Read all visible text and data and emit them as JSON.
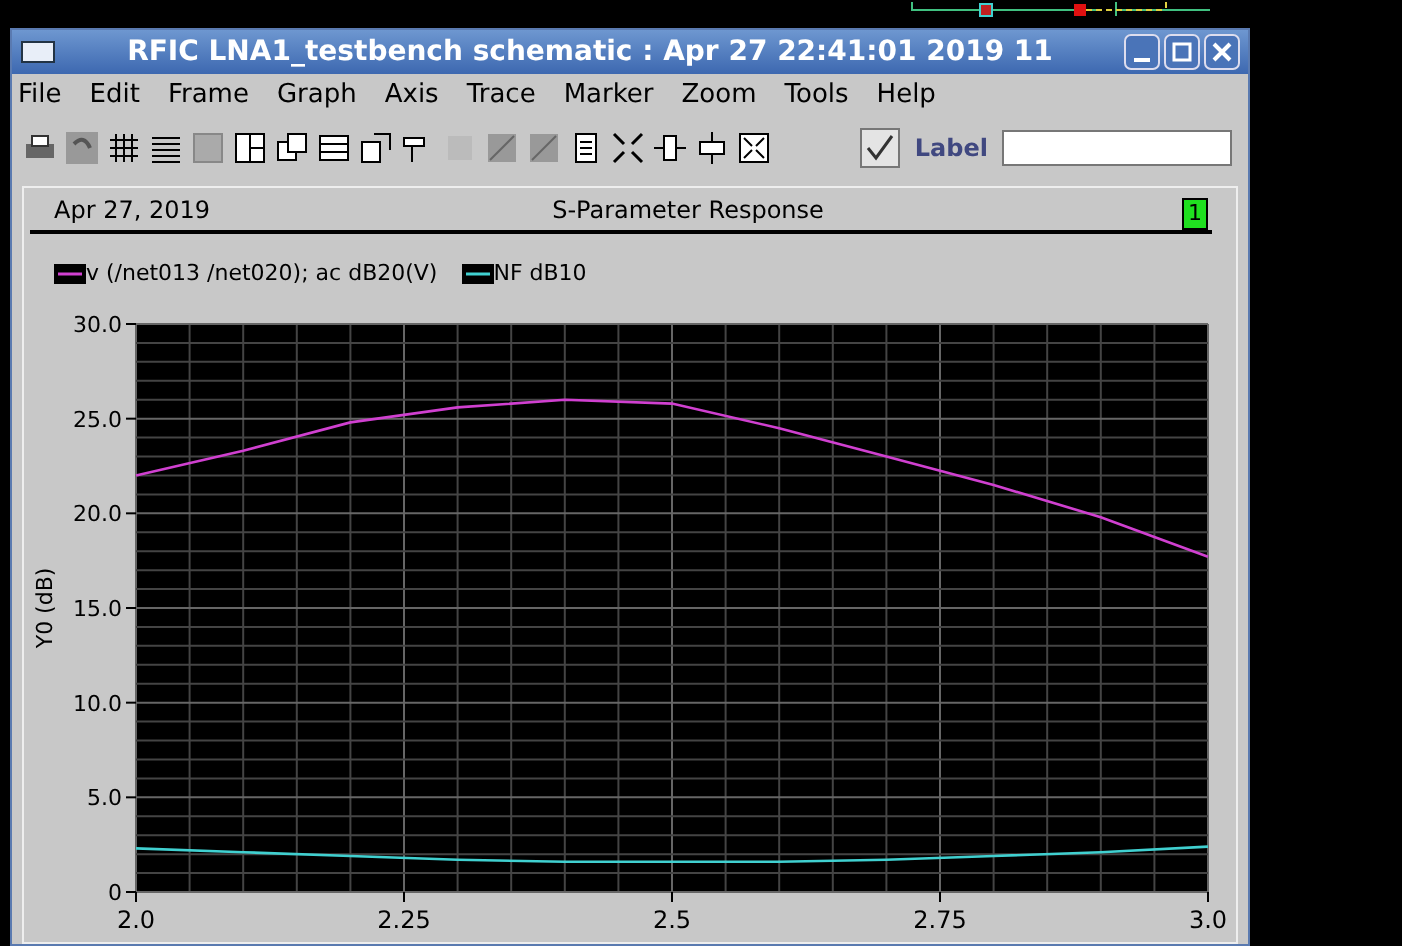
{
  "window": {
    "title": "RFIC LNA1_testbench schematic : Apr 27 22:41:01 2019 11"
  },
  "menu": [
    "File",
    "Edit",
    "Frame",
    "Graph",
    "Axis",
    "Trace",
    "Marker",
    "Zoom",
    "Tools",
    "Help"
  ],
  "toolbar": {
    "label_checkbox": {
      "label": "Label",
      "checked": true
    }
  },
  "panel": {
    "date": "Apr 27, 2019",
    "title": "S-Parameter Response",
    "page": "1"
  },
  "chart": {
    "chart_data": {
      "type": "line",
      "ylabel": "Y0 (dB)",
      "x": [
        2.0,
        2.1,
        2.2,
        2.3,
        2.4,
        2.5,
        2.6,
        2.7,
        2.8,
        2.9,
        3.0
      ],
      "series": [
        {
          "name": "v (/net013 /net020); ac dB20(V)",
          "color": "#d040d0",
          "values": [
            22.0,
            23.3,
            24.8,
            25.6,
            26.0,
            25.8,
            24.5,
            23.0,
            21.5,
            19.8,
            17.7
          ]
        },
        {
          "name": "NF dB10",
          "color": "#40d0d0",
          "values": [
            2.3,
            2.1,
            1.9,
            1.7,
            1.6,
            1.6,
            1.6,
            1.7,
            1.9,
            2.1,
            2.4
          ]
        }
      ],
      "grid": true,
      "xlim": [
        2.0,
        3.0
      ],
      "ylim": [
        0,
        30
      ],
      "xticks": [
        {
          "value": 2.0,
          "label": "2.0"
        },
        {
          "value": 2.25,
          "label": "2.25"
        },
        {
          "value": 2.5,
          "label": "2.5"
        },
        {
          "value": 2.75,
          "label": "2.75"
        },
        {
          "value": 3.0,
          "label": "3.0"
        }
      ],
      "yticks": [
        {
          "value": 0,
          "label": "0"
        },
        {
          "value": 5,
          "label": "5.0"
        },
        {
          "value": 10,
          "label": "10.0"
        },
        {
          "value": 15,
          "label": "15.0"
        },
        {
          "value": 20,
          "label": "20.0"
        },
        {
          "value": 25,
          "label": "25.0"
        },
        {
          "value": 30,
          "label": "30.0"
        }
      ]
    }
  }
}
